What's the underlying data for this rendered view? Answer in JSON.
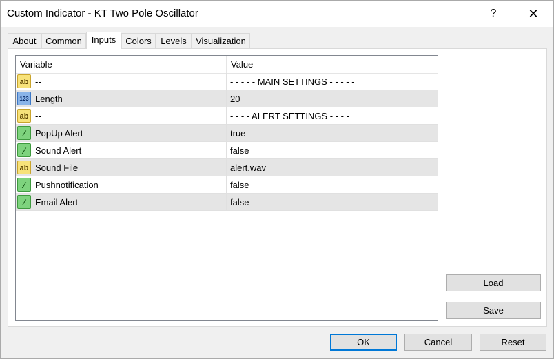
{
  "window": {
    "title": "Custom Indicator - KT Two Pole Oscillator",
    "help_label": "?",
    "close_label": "✕"
  },
  "tabs": [
    {
      "label": "About"
    },
    {
      "label": "Common"
    },
    {
      "label": "Inputs",
      "active": true
    },
    {
      "label": "Colors"
    },
    {
      "label": "Levels"
    },
    {
      "label": "Visualization"
    }
  ],
  "grid": {
    "columns": [
      "Variable",
      "Value"
    ],
    "rows": [
      {
        "icon": "ab",
        "variable": "--",
        "value": "- - - - - MAIN SETTINGS - - - - -"
      },
      {
        "icon": "123",
        "variable": "Length",
        "value": "20"
      },
      {
        "icon": "ab",
        "variable": "--",
        "value": "- - - - ALERT SETTINGS - - - -"
      },
      {
        "icon": "bool",
        "variable": "PopUp Alert",
        "value": "true"
      },
      {
        "icon": "bool",
        "variable": "Sound Alert",
        "value": "false"
      },
      {
        "icon": "ab",
        "variable": "Sound File",
        "value": "alert.wav"
      },
      {
        "icon": "bool",
        "variable": "Pushnotification",
        "value": "false"
      },
      {
        "icon": "bool",
        "variable": "Email Alert",
        "value": "false"
      }
    ]
  },
  "side_buttons": {
    "load": "Load",
    "save": "Save"
  },
  "footer_buttons": {
    "ok": "OK",
    "cancel": "Cancel",
    "reset": "Reset"
  }
}
